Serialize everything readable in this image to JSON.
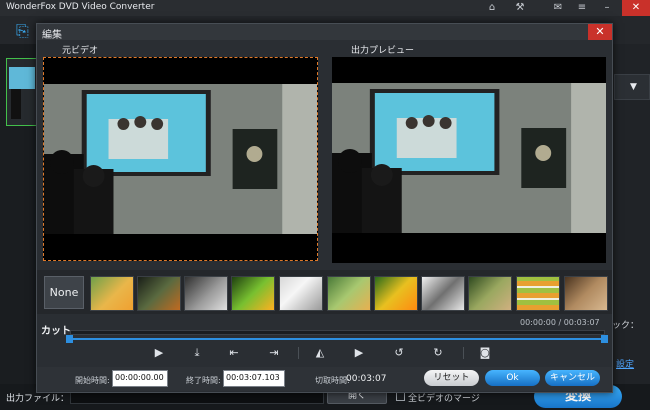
{
  "app": {
    "title": "WonderFox DVD Video Converter",
    "titlebar_icons": [
      "home-icon",
      "tools-icon",
      "chat-icon",
      "menu-icon",
      "minimize-icon"
    ],
    "close_glyph": "✕"
  },
  "main": {
    "right_text": "ック：",
    "right_link": "設定",
    "output_label": "出力ファイル：",
    "open_button": "開く",
    "merge_label": "全ビデオのマージ",
    "convert_button": "変換"
  },
  "dialog": {
    "title": "編集",
    "close_glyph": "✕",
    "original_label": "元ビデオ",
    "preview_label": "出力プレビュー",
    "filters": {
      "none_label": "None",
      "items": [
        "flowers-original",
        "flowers-dark",
        "flowers-grayscale",
        "flowers-vivid",
        "flowers-emboss",
        "flowers-soft",
        "flowers-saturated",
        "flowers-sketch",
        "flowers-noise",
        "flowers-mosaic",
        "flowers-sepia"
      ]
    },
    "cut_label": "カット",
    "time_readout": "00:00:00 / 00:03:07",
    "start_label": "開始時間:",
    "start_value": "00:00:00.00",
    "end_label": "終了時間:",
    "end_value": "00:03:07.103",
    "duration_label": "切取時間:",
    "duration_value": "00:03:07",
    "reset_button": "リセット",
    "ok_button": "Ok",
    "cancel_button": "キャンセル",
    "range": {
      "start": 0.0,
      "end": 1.0
    }
  },
  "colors": {
    "accent": "#2d8fe0",
    "selection_border": "#e07a2a",
    "close_red": "#c9312a",
    "thumb_border": "#43c04b"
  }
}
